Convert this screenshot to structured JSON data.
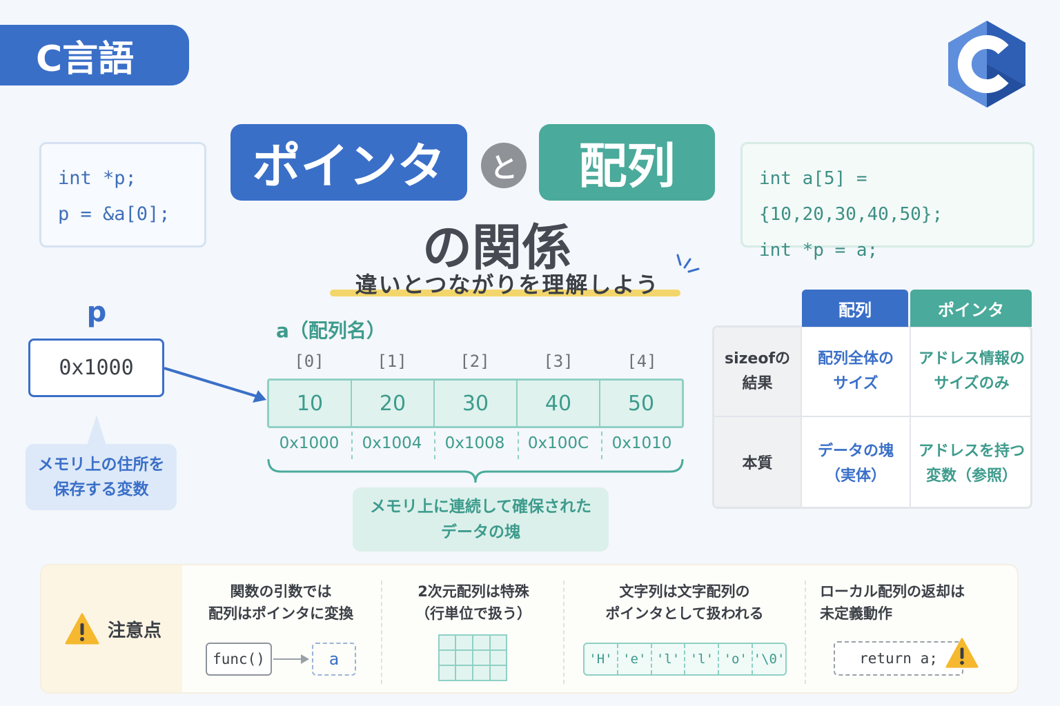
{
  "tag": {
    "label": "C言語"
  },
  "title": {
    "pointer": "ポインタ",
    "connector": "と",
    "array": "配列",
    "relation": "の関係",
    "subtitle": "違いとつながりを理解しよう"
  },
  "code_left": {
    "lines": [
      "int *p;",
      "p = &a[0];"
    ]
  },
  "code_right": {
    "lines": [
      "int a[5] = {10,20,30,40,50};",
      "int *p = a;"
    ]
  },
  "pointer_var": {
    "name": "p",
    "value": "0x1000",
    "note_line1": "メモリ上の住所を",
    "note_line2": "保存する変数"
  },
  "array": {
    "name": "a（配列名）",
    "indices": [
      "[0]",
      "[1]",
      "[2]",
      "[3]",
      "[4]"
    ],
    "values": [
      "10",
      "20",
      "30",
      "40",
      "50"
    ],
    "addresses": [
      "0x1000",
      "0x1004",
      "0x1008",
      "0x100C",
      "0x1010"
    ],
    "note_line1": "メモリ上に連続して確保された",
    "note_line2": "データの塊"
  },
  "table": {
    "headers": [
      "配列",
      "ポインタ"
    ],
    "rows": [
      {
        "head_line1": "sizeofの",
        "head_line2": "結果",
        "array_line1": "配列全体の",
        "array_line2": "サイズ",
        "pointer_line1": "アドレス情報の",
        "pointer_line2": "サイズのみ"
      },
      {
        "head_line1": "本質",
        "head_line2": "",
        "array_line1": "データの塊",
        "array_line2": "（実体）",
        "pointer_line1": "アドレスを持つ",
        "pointer_line2": "変数（参照）"
      }
    ]
  },
  "notes": {
    "label": "注意点",
    "items": [
      {
        "line1": "関数の引数では",
        "line2": "配列はポインタに変換",
        "code_func": "func()",
        "code_arg": "a"
      },
      {
        "line1": "2次元配列は特殊",
        "line2": "（行単位で扱う）"
      },
      {
        "line1": "文字列は文字配列の",
        "line2": "ポインタとして扱われる",
        "chars": [
          "'H'",
          "'e'",
          "'l'",
          "'l'",
          "'o'",
          "'\\0'"
        ]
      },
      {
        "line1": "ローカル配列の返却は",
        "line2": "未定義動作",
        "code": "return a;"
      }
    ]
  },
  "colors": {
    "blue": "#3a6fc8",
    "teal": "#4aaa9b",
    "warning": "#f5b82e"
  }
}
